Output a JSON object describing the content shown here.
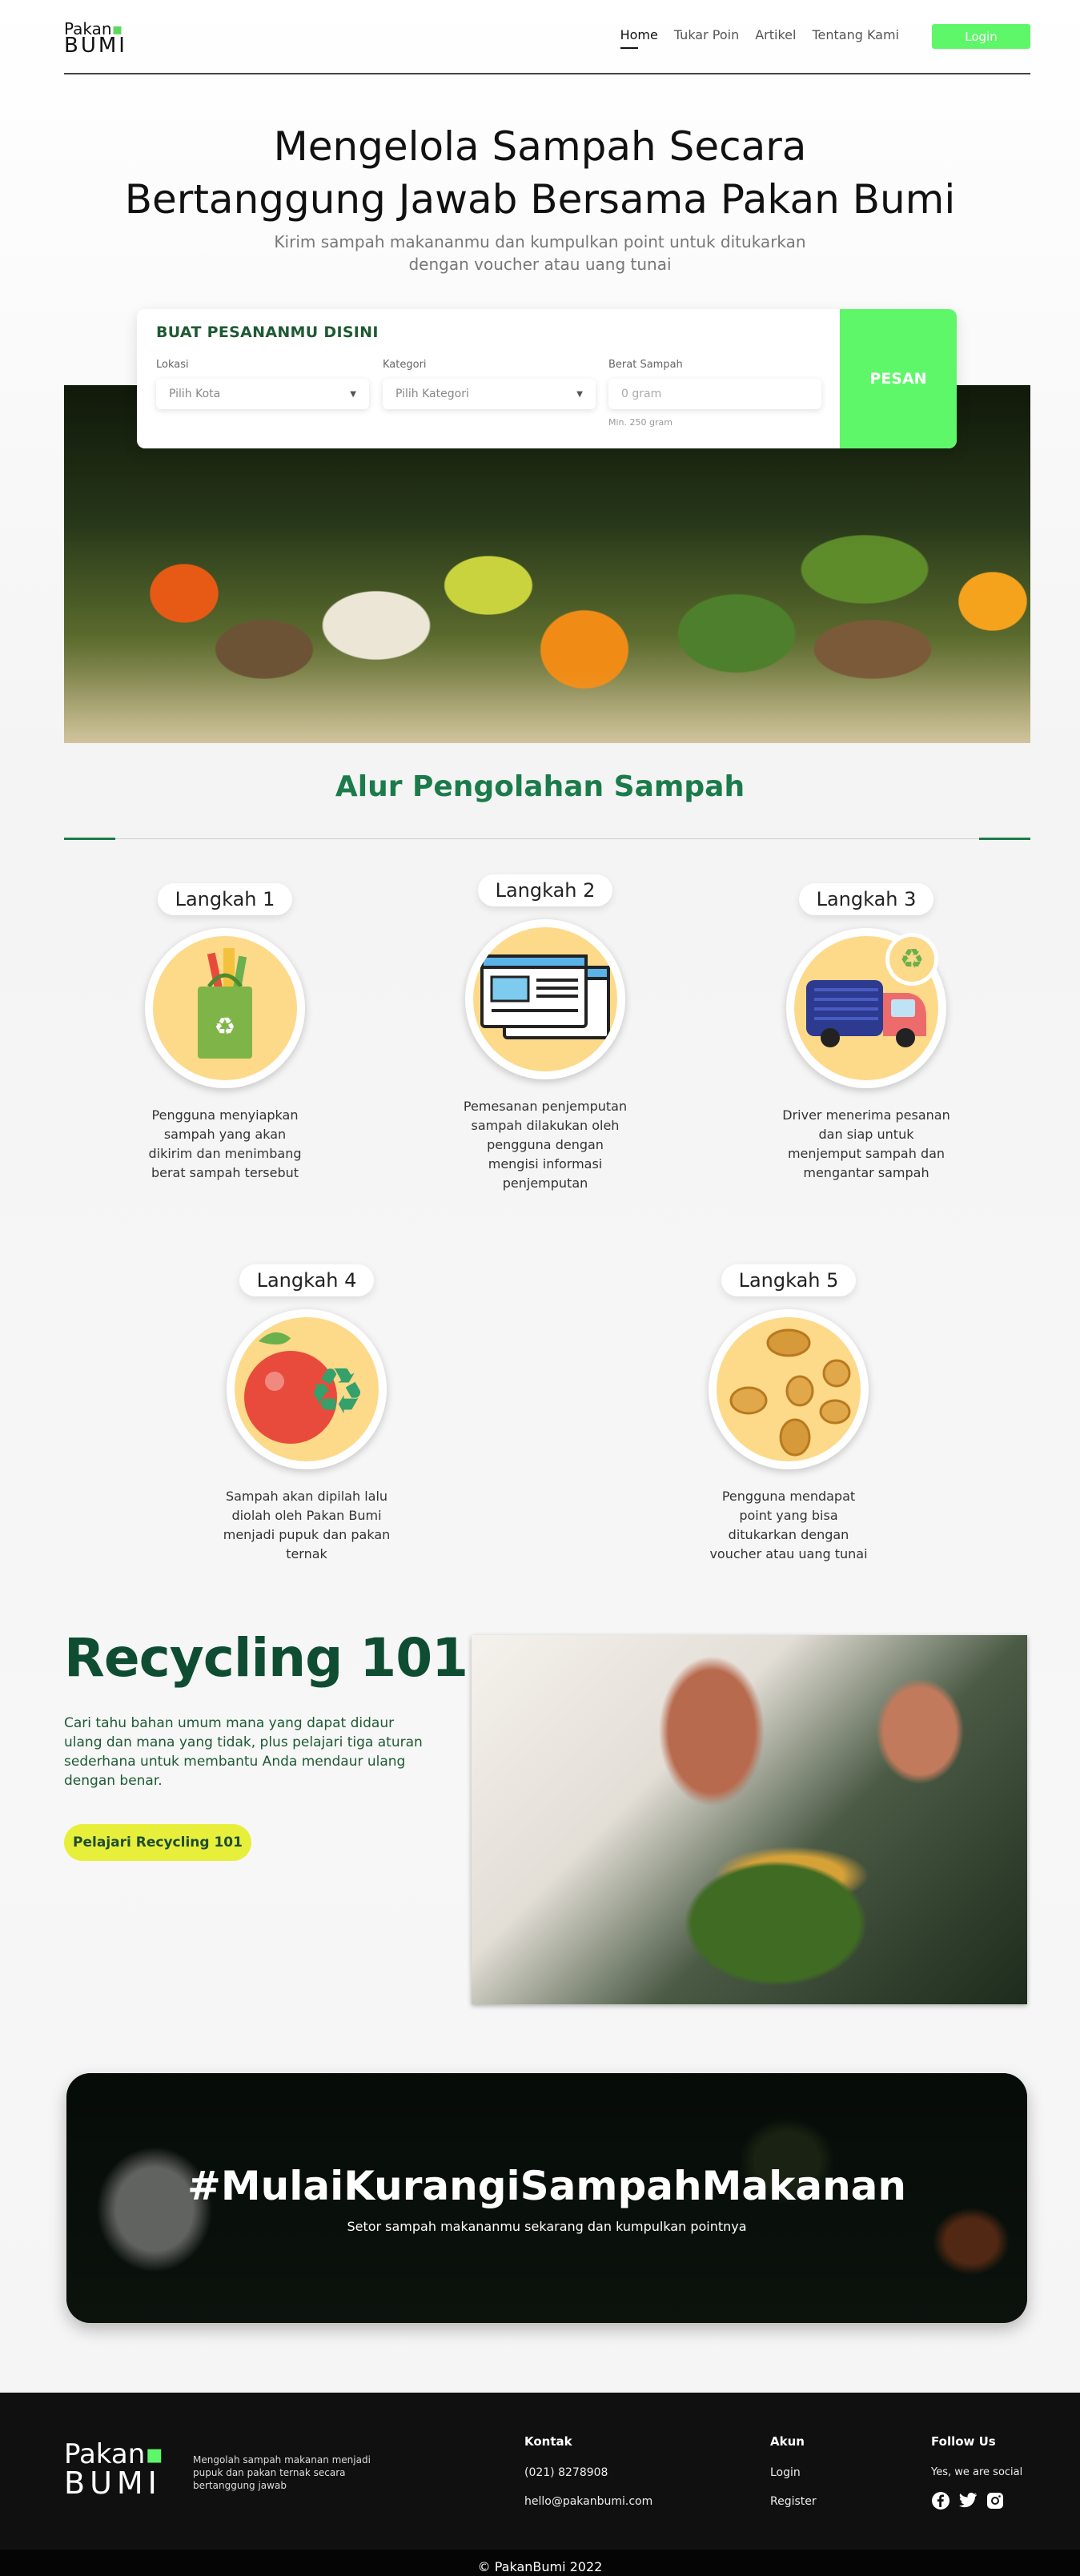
{
  "nav": {
    "logo_top": "Pakan",
    "logo_bottom": "BUMI",
    "links": [
      "Home",
      "Tukar Poin",
      "Artikel",
      "Tentang Kami"
    ],
    "login_label": "Login"
  },
  "hero": {
    "title_line1": "Mengelola Sampah Secara",
    "title_line2": "Bertanggung Jawab Bersama Pakan Bumi",
    "subtitle_line1": "Kirim sampah makananmu dan kumpulkan point untuk ditukarkan",
    "subtitle_line2": "dengan voucher atau uang tunai"
  },
  "order": {
    "title": "BUAT PESANANMU DISINI",
    "location_label": "Lokasi",
    "location_value": "Pilih Kota",
    "category_label": "Kategori",
    "category_value": "Pilih Kategori",
    "weight_label": "Berat Sampah",
    "weight_placeholder": "0 gram",
    "weight_hint": "Min. 250 gram",
    "submit_label": "PESAN"
  },
  "alur": {
    "title": "Alur Pengolahan Sampah",
    "steps": [
      {
        "label": "Langkah 1",
        "text": "Pengguna menyiapkan sampah yang akan dikirim dan menimbang berat sampah tersebut",
        "icon": "shopping-bag-icon"
      },
      {
        "label": "Langkah 2",
        "text": "Pemesanan penjemputan sampah dilakukan oleh pengguna dengan mengisi informasi penjemputan",
        "icon": "browser-form-icon"
      },
      {
        "label": "Langkah 3",
        "text": "Driver menerima pesanan dan siap untuk menjemput sampah dan mengantar sampah",
        "icon": "truck-icon"
      },
      {
        "label": "Langkah 4",
        "text": "Sampah akan dipilah lalu diolah oleh Pakan Bumi menjadi pupuk dan pakan ternak",
        "icon": "apple-recycle-icon"
      },
      {
        "label": "Langkah 5",
        "text": "Pengguna mendapat point yang bisa ditukarkan dengan voucher atau uang tunai",
        "icon": "coins-icon"
      }
    ]
  },
  "recycling": {
    "title": "Recycling 101",
    "text": "Cari tahu bahan umum mana yang dapat didaur ulang dan mana yang tidak, plus pelajari tiga aturan sederhana untuk membantu Anda mendaur ulang dengan benar.",
    "button_label": "Pelajari Recycling 101"
  },
  "banner": {
    "title": "#MulaiKurangiSampahMakanan",
    "subtitle": "Setor sampah makananmu sekarang dan kumpulkan pointnya"
  },
  "footer": {
    "logo_top": "Pakan",
    "logo_bottom": "BUMI",
    "description": "Mengolah sampah makanan menjadi pupuk dan pakan ternak secara bertanggung jawab",
    "kontak_title": "Kontak",
    "phone": "(021) 8278908",
    "email": "hello@pakanbumi.com",
    "akun_title": "Akun",
    "akun_login": "Login",
    "akun_register": "Register",
    "follow_title": "Follow Us",
    "follow_text": "Yes, we are social",
    "copyright": "© PakanBumi 2022"
  },
  "colors": {
    "accent_green": "#5ff76a",
    "dark_green": "#1b7b4a",
    "yellow_button": "#e7ef3b"
  }
}
